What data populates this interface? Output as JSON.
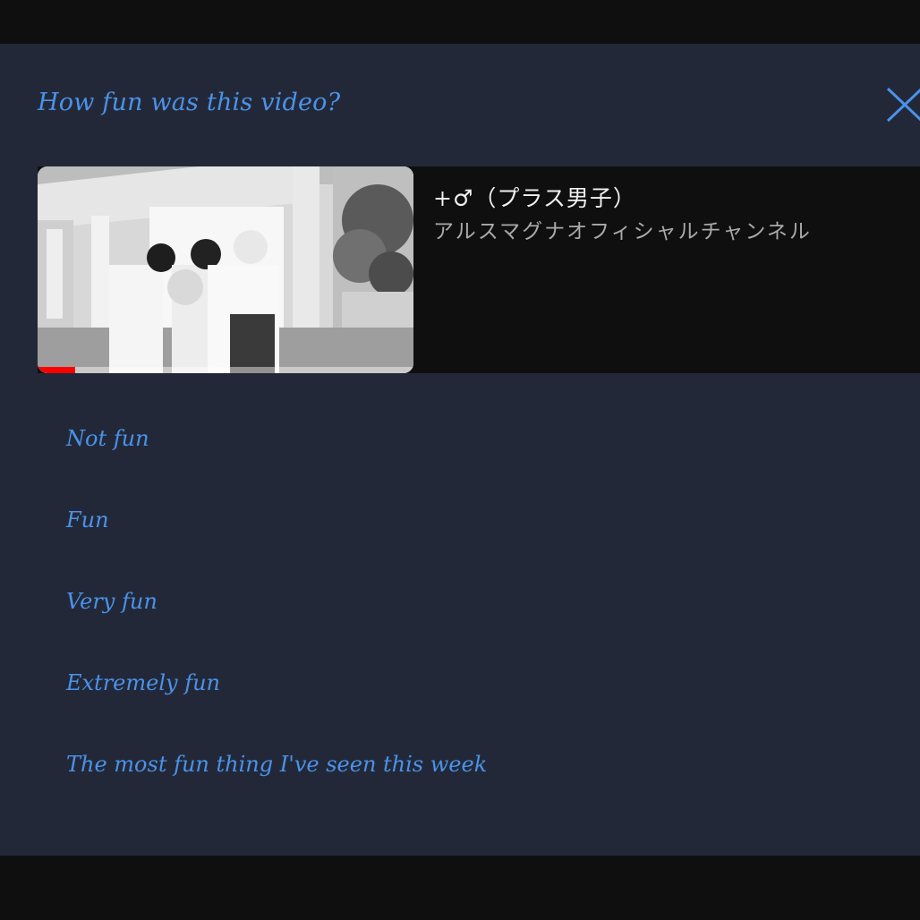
{
  "dialog": {
    "title": "How fun was this video?",
    "close_icon": "close-icon"
  },
  "video": {
    "title": "+♂（プラス男子）",
    "channel": "アルスマグナオフィシャルチャンネル",
    "progress_fraction": 0.1
  },
  "options": [
    {
      "label": "Not fun"
    },
    {
      "label": "Fun"
    },
    {
      "label": "Very fun"
    },
    {
      "label": "Extremely fun"
    },
    {
      "label": "The most fun thing I've seen this week"
    }
  ],
  "colors": {
    "accent": "#4a93e8",
    "dialog_background": "#232839",
    "progress": "#ff0000"
  }
}
